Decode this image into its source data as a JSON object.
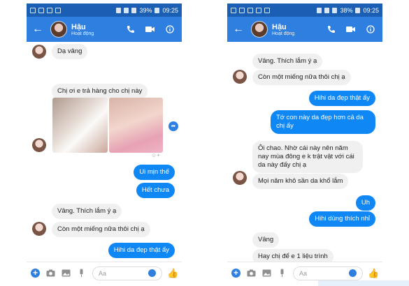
{
  "status_left": {
    "battery": "39%",
    "time": "09:25"
  },
  "status_right": {
    "battery": "38%",
    "time": "09:25"
  },
  "contact": {
    "name": "Hậu",
    "status": "Hoạt động"
  },
  "composer": {
    "placeholder": "Aa"
  },
  "left_messages": [
    {
      "text": "Dạ vâng",
      "dir": "in"
    },
    {
      "text": "Chị ơi e trả hàng cho chị này",
      "dir": "in"
    },
    {
      "text": "Ui mịn thế",
      "dir": "out"
    },
    {
      "text": "Hết chưa",
      "dir": "out"
    },
    {
      "text": "Vâng. Thích lắm ý ạ",
      "dir": "in"
    },
    {
      "text": "Còn một miếng nữa thôi chị ạ",
      "dir": "in"
    },
    {
      "text": "Hihi da đẹp thật ấy",
      "dir": "out"
    }
  ],
  "right_messages": [
    {
      "text": "Vâng. Thích lắm ý ạ",
      "dir": "in"
    },
    {
      "text": "Còn một miếng nữa thôi chị ạ",
      "dir": "in"
    },
    {
      "text": "Hihi da đẹp thật ấy",
      "dir": "out"
    },
    {
      "text": "Tớ con này da đẹp hơn cả da chị ấy",
      "dir": "out"
    },
    {
      "text": "Ôi chao. Nhờ cái này nên năm nay mùa đông e k trật vật với cái da này đấy chị ạ",
      "dir": "in"
    },
    {
      "text": "Mọi năm khô sần da khổ lắm",
      "dir": "in"
    },
    {
      "text": "Uh",
      "dir": "out"
    },
    {
      "text": "Hihi dùng thích nhỉ",
      "dir": "out"
    },
    {
      "text": "Vâng",
      "dir": "in"
    },
    {
      "text": "Hay chị để e 1 liệu trình",
      "dir": "in"
    }
  ]
}
